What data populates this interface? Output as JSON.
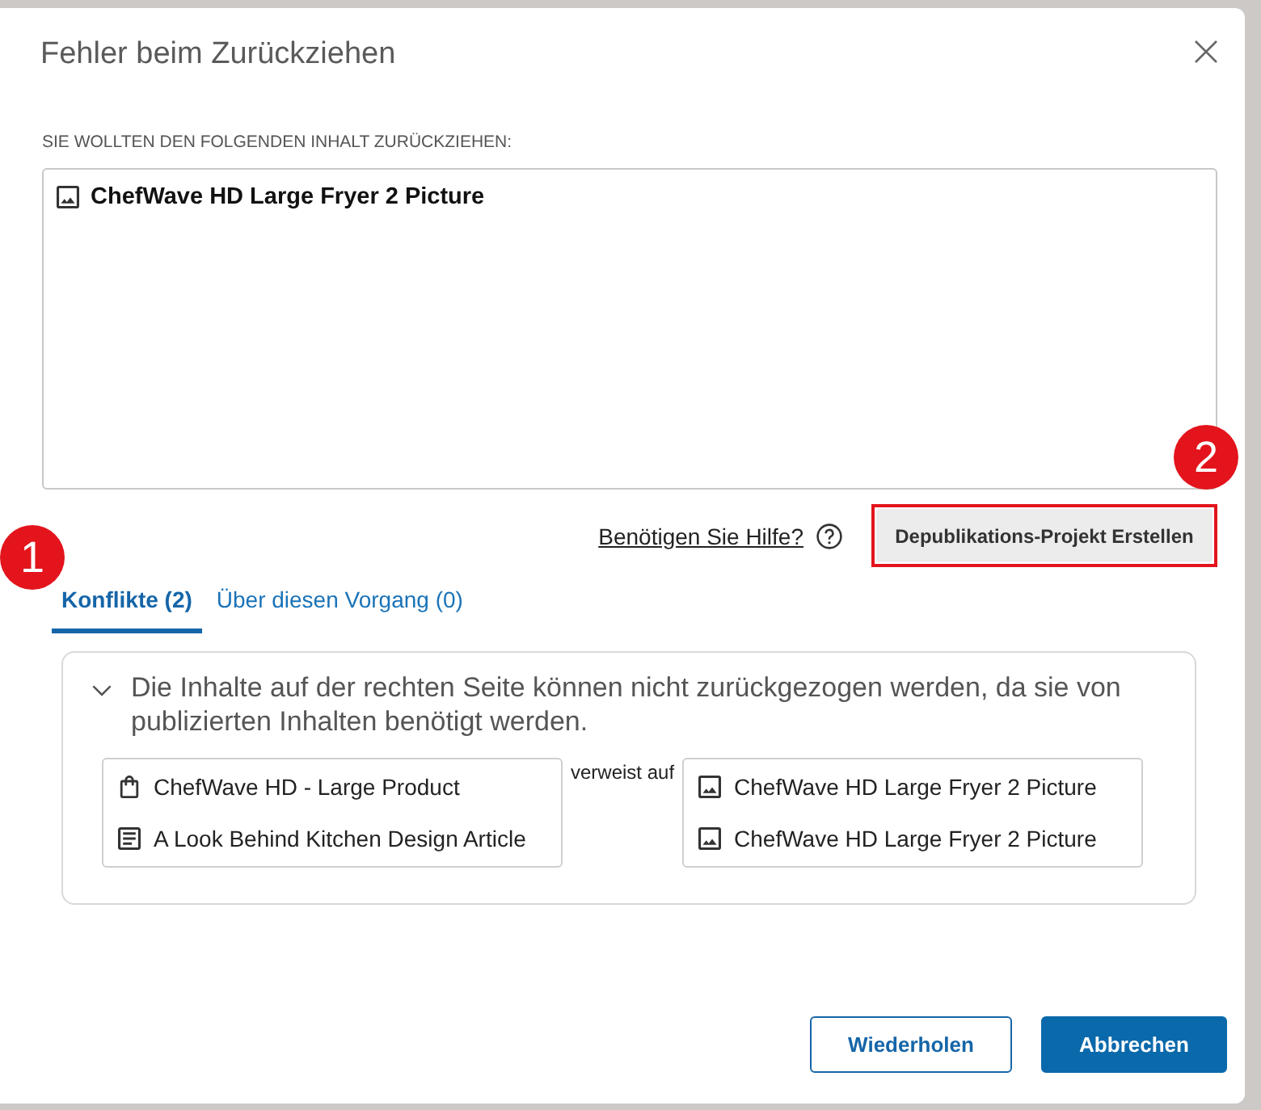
{
  "dialog": {
    "title": "Fehler beim Zurückziehen"
  },
  "content_label": "SIE WOLLTEN DEN FOLGENDEN INHALT ZURÜCKZIEHEN:",
  "content_items": [
    {
      "kind": "image",
      "label": "ChefWave HD Large Fryer 2 Picture"
    }
  ],
  "help_link": "Benötigen Sie Hilfe?",
  "create_button": {
    "label": "Depublikations-Projekt Erstellen",
    "highlighted": true
  },
  "tabs": [
    {
      "label": "Konflikte (2)",
      "selected": true
    },
    {
      "label": "Über diesen Vorgang (0)",
      "selected": false
    }
  ],
  "conflicts": [
    {
      "expanded": true,
      "message": "Die Inhalte auf der rechten Seite können nicht zurückgezogen werden, da sie von publizierten Inhalten benötigt werden.",
      "sources": [
        {
          "kind": "product",
          "label": "ChefWave HD - Large Product"
        },
        {
          "kind": "article",
          "label": "A Look Behind Kitchen Design Article"
        }
      ],
      "relation": "verweist auf",
      "targets": [
        {
          "kind": "image",
          "label": "ChefWave HD Large Fryer 2 Picture"
        },
        {
          "kind": "image",
          "label": "ChefWave HD Large Fryer 2 Picture"
        }
      ]
    }
  ],
  "buttons": [
    {
      "kind": "secondary",
      "label": "Wiederholen"
    },
    {
      "kind": "primary",
      "label": "Abbrechen"
    }
  ],
  "callouts": [
    {
      "label": "1"
    },
    {
      "label": "2"
    }
  ]
}
